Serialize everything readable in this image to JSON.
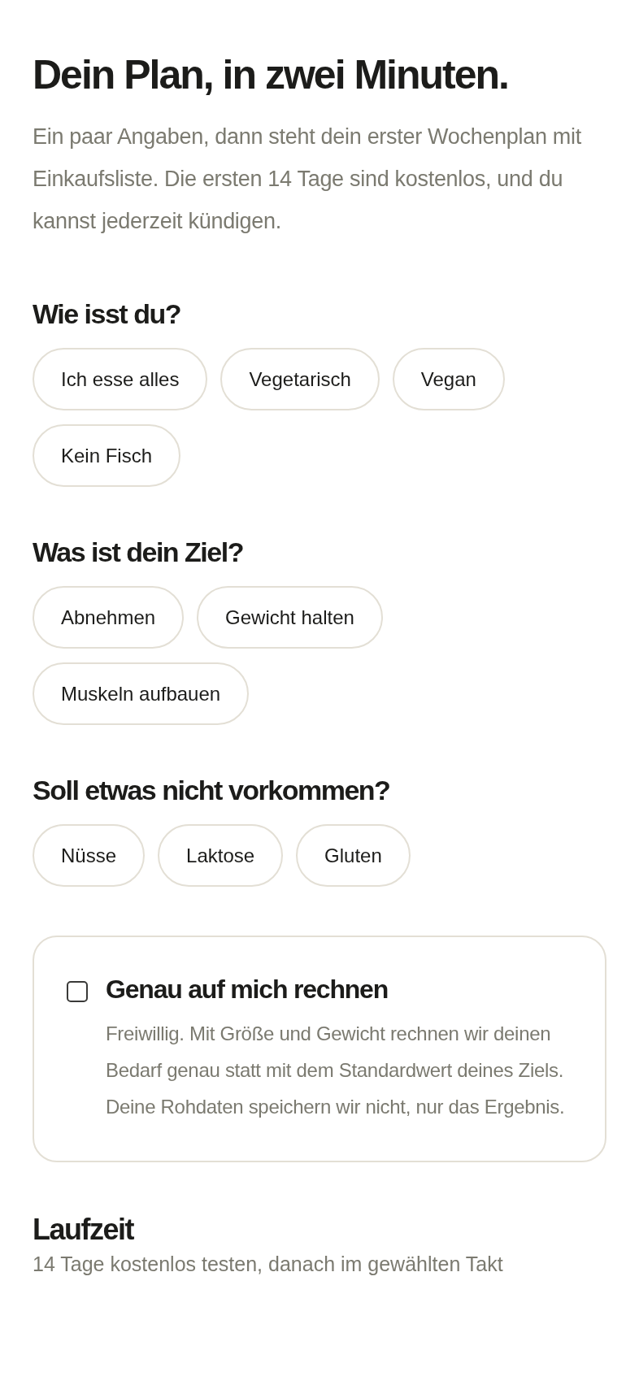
{
  "title": "Dein Plan, in zwei Minuten.",
  "intro": "Ein paar Angaben, dann steht dein erster Wochenplan mit Einkaufsliste. Die ersten 14 Tage sind kostenlos, und du kannst jederzeit kündigen.",
  "groups": [
    {
      "heading": "Wie isst du?",
      "options": [
        {
          "label": "Ich esse alles",
          "selected": false
        },
        {
          "label": "Vegetarisch",
          "selected": false
        },
        {
          "label": "Vegan",
          "selected": false
        },
        {
          "label": "Kein Fisch",
          "selected": false
        }
      ]
    },
    {
      "heading": "Was ist dein Ziel?",
      "options": [
        {
          "label": "Abnehmen",
          "selected": false
        },
        {
          "label": "Gewicht halten",
          "selected": false
        },
        {
          "label": "Muskeln aufbauen",
          "selected": false
        }
      ]
    },
    {
      "heading": "Soll etwas nicht vorkommen?",
      "options": [
        {
          "label": "Nüsse",
          "selected": false
        },
        {
          "label": "Laktose",
          "selected": false
        },
        {
          "label": "Gluten",
          "selected": false
        }
      ]
    }
  ],
  "precise": {
    "label": "Genau auf mich rechnen",
    "checked": false,
    "description": "Freiwillig. Mit Größe und Gewicht rechnen wir deinen Bedarf genau statt mit dem Standardwert deines Ziels. Deine Rohdaten speichern wir nicht, nur das Ergebnis."
  },
  "duration": {
    "heading": "Laufzeit",
    "text": "14 Tage kostenlos testen, danach im gewählten Takt"
  }
}
